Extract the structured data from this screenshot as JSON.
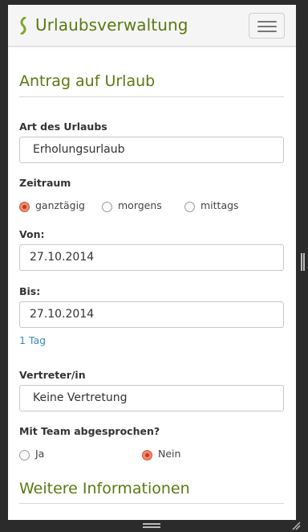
{
  "header": {
    "title": "Urlaubsverwaltung",
    "logo_icon": "leaf-logo-icon",
    "menu_icon": "hamburger-menu-icon"
  },
  "form": {
    "section_title": "Antrag auf Urlaub",
    "type_label": "Art des Urlaubs",
    "type_value": "Erholungsurlaub",
    "period_label": "Zeitraum",
    "period_options": [
      "ganztägig",
      "morgens",
      "mittags"
    ],
    "period_selected": "ganztägig",
    "from_label": "Von:",
    "from_value": "27.10.2014",
    "to_label": "Bis:",
    "to_value": "27.10.2014",
    "duration": "1 Tag",
    "rep_label": "Vertreter/in",
    "rep_value": "Keine Vertretung",
    "team_label": "Mit Team abgesprochen?",
    "team_options": [
      "Ja",
      "Nein"
    ],
    "team_selected": "Nein"
  },
  "more": {
    "section_title": "Weitere Informationen"
  },
  "colors": {
    "brand": "#5a7a12",
    "radio_selected": "#f28b6b",
    "link": "#3d8bb4"
  }
}
